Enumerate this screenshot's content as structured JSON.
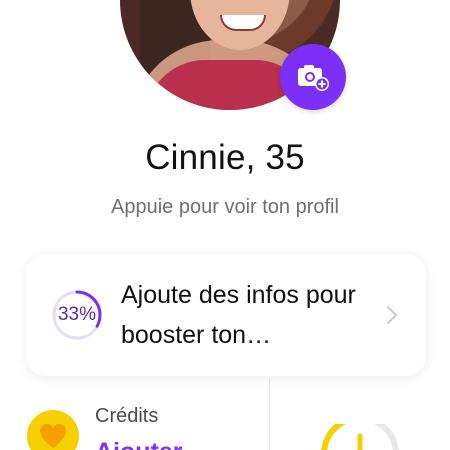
{
  "profile": {
    "name": "Cinnie, 35",
    "subtitle": "Appuie pour voir ton profil"
  },
  "completion_card": {
    "percent_label": "33%",
    "progress": 0.33,
    "text": "Ajoute des infos pour booster ton…"
  },
  "credits": {
    "label": "Crédits",
    "action": "Ajouter"
  },
  "icons": {
    "photo": "camera-plus-icon",
    "chevron": "chevron-right-icon",
    "credits": "heart-coin-icon",
    "gauge": "gauge-icon"
  },
  "colors": {
    "accent": "#7b2ff7",
    "credit_yellow": "#f5cf00",
    "progress_ring": "#7b2ff7",
    "progress_track": "#e5ddf5"
  }
}
